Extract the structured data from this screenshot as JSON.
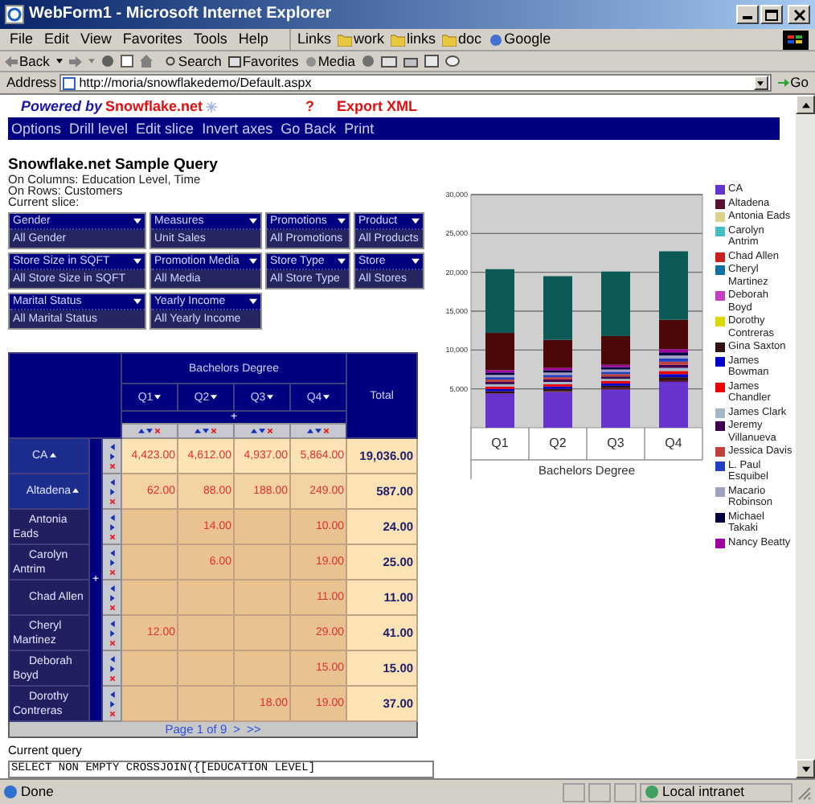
{
  "window": {
    "title": "WebForm1 - Microsoft Internet Explorer"
  },
  "menu_bar": [
    "File",
    "Edit",
    "View",
    "Favorites",
    "Tools",
    "Help"
  ],
  "links": {
    "label": "Links",
    "items": [
      "work",
      "links",
      "doc",
      "Google"
    ]
  },
  "toolbar": {
    "back": "Back",
    "search": "Search",
    "favorites": "Favorites",
    "media": "Media"
  },
  "address_bar": {
    "label": "Address",
    "url": "http://moria/snowflakedemo/Default.aspx",
    "go": "Go"
  },
  "page": {
    "powered_by": "Powered by",
    "brand": "Snowflake.net",
    "help": "?",
    "export": "Export XML",
    "nav": [
      "Options",
      "Drill level",
      "Edit slice",
      "Invert axes",
      "Go Back",
      "Print"
    ],
    "title": "Snowflake.net Sample Query",
    "info": [
      "On Columns: Education Level, Time",
      "On Rows: Customers",
      "Current slice:"
    ],
    "slicers": [
      {
        "dimension": "Gender",
        "value": "All Gender"
      },
      {
        "dimension": "Measures",
        "value": "Unit Sales"
      },
      {
        "dimension": "Promotions",
        "value": "All Promotions"
      },
      {
        "dimension": "Product",
        "value": "All Products"
      },
      {
        "dimension": "Store Size in SQFT",
        "value": "All Store Size in SQFT"
      },
      {
        "dimension": "Promotion Media",
        "value": "All Media"
      },
      {
        "dimension": "Store Type",
        "value": "All Store Type"
      },
      {
        "dimension": "Store",
        "value": "All Stores"
      },
      {
        "dimension": "Marital Status",
        "value": "All Marital Status"
      },
      {
        "dimension": "Yearly Income",
        "value": "All Yearly Income"
      }
    ],
    "pivot": {
      "column_group": "Bachelors Degree",
      "columns": [
        "Q1",
        "Q2",
        "Q3",
        "Q4"
      ],
      "column_expand": "+",
      "total": "Total",
      "row_expand": "+",
      "rows": [
        {
          "name": "CA",
          "expanded": true,
          "q1": "4,423.00",
          "q2": "4,612.00",
          "q3": "4,937.00",
          "q4": "5,864.00",
          "total": "19,036.00",
          "children": [
            {
              "name": "Altadena",
              "expanded": true,
              "q1": "62.00",
              "q2": "88.00",
              "q3": "188.00",
              "q4": "249.00",
              "total": "587.00",
              "children": [
                {
                  "name": "Antonia Eads",
                  "q2": "14.00",
                  "q4": "10.00",
                  "total": "24.00"
                },
                {
                  "name": "Carolyn Antrim",
                  "q2": "6.00",
                  "q4": "19.00",
                  "total": "25.00"
                },
                {
                  "name": "Chad Allen",
                  "q4": "11.00",
                  "total": "11.00"
                },
                {
                  "name": "Cheryl Martinez",
                  "q1": "12.00",
                  "q4": "29.00",
                  "total": "41.00"
                },
                {
                  "name": "Deborah Boyd",
                  "q4": "15.00",
                  "total": "15.00"
                },
                {
                  "name": "Dorothy Contreras",
                  "q3": "18.00",
                  "q4": "19.00",
                  "total": "37.00"
                }
              ]
            }
          ]
        }
      ],
      "pager": {
        "text": "Page 1 of",
        "count": "9",
        "next": ">",
        "last": ">>"
      }
    },
    "chart": {
      "chart_data": {
        "type": "bar",
        "stacked": true,
        "grid": true,
        "xlabel": "Bachelors Degree",
        "categories": [
          "Q1",
          "Q2",
          "Q3",
          "Q4"
        ],
        "ylim": [
          0,
          30000
        ],
        "yticks": [
          {
            "value": 5000,
            "label": "5,000"
          },
          {
            "value": 10000,
            "label": "10,000"
          },
          {
            "value": 15000,
            "label": "15,000"
          },
          {
            "value": 20000,
            "label": "20,000"
          },
          {
            "value": 25000,
            "label": "25,000"
          },
          {
            "value": 30000,
            "label": "30,000"
          }
        ],
        "series": [
          {
            "name": "CA",
            "color": "#6633cc",
            "values": [
              4400,
              4600,
              4900,
              5900
            ]
          },
          {
            "name": "Altadena",
            "color": "#5a1030",
            "values": [
              null,
              100,
              200,
              200
            ]
          },
          {
            "name": "Antonia Eads",
            "color": "#e0d090",
            "values": [
              null,
              null,
              null,
              null
            ]
          },
          {
            "name": "Carolyn Antrim",
            "color": "#40c0c0",
            "values": [
              null,
              null,
              null,
              null
            ]
          },
          {
            "name": "Chad Allen",
            "color": "#cc2020",
            "values": [
              null,
              null,
              null,
              null
            ]
          },
          {
            "name": "Cheryl Martinez",
            "color": "#1070a0",
            "values": [
              null,
              null,
              null,
              null
            ]
          },
          {
            "name": "Deborah Boyd",
            "color": "#c040c0",
            "values": [
              null,
              null,
              null,
              null
            ]
          },
          {
            "name": "Dorothy Contreras",
            "color": "#d8d800",
            "values": [
              null,
              null,
              null,
              null
            ]
          },
          {
            "name": "Gina Saxton",
            "color": "#301010",
            "values": [
              300,
              300,
              300,
              400
            ]
          },
          {
            "name": "James Bowman",
            "color": "#0000cc",
            "values": [
              300,
              300,
              300,
              400
            ]
          },
          {
            "name": "James Chandler",
            "color": "#ee0000",
            "values": [
              300,
              300,
              300,
              400
            ]
          },
          {
            "name": "James Clark",
            "color": "#a0b8c8",
            "values": [
              300,
              300,
              300,
              400
            ]
          },
          {
            "name": "Jeremy Villanueva",
            "color": "#400050",
            "values": [
              300,
              300,
              300,
              400
            ]
          },
          {
            "name": "Jessica Davis",
            "color": "#c04040",
            "values": [
              300,
              300,
              300,
              400
            ]
          },
          {
            "name": "L. Paul Esquibel",
            "color": "#2040c0",
            "values": [
              300,
              300,
              300,
              400
            ]
          },
          {
            "name": "Macario Robinson",
            "color": "#a0a0c0",
            "values": [
              300,
              300,
              300,
              400
            ]
          },
          {
            "name": "Michael Takaki",
            "color": "#000040",
            "values": [
              300,
              300,
              300,
              400
            ]
          },
          {
            "name": "Nancy Beatty",
            "color": "#a000a0",
            "values": [
              300,
              300,
              300,
              400
            ]
          },
          {
            "color": "#4a0808",
            "values": [
              4800,
              3600,
              3700,
              3800
            ]
          },
          {
            "color": "#0c5a55",
            "values": [
              8200,
              8200,
              8300,
              8800
            ]
          }
        ]
      }
    },
    "query": {
      "label": "Current query",
      "value": "SELECT NON EMPTY CROSSJOIN({[EDUCATION LEVEL]"
    }
  },
  "status_bar": {
    "text": "Done",
    "zone": "Local intranet"
  }
}
